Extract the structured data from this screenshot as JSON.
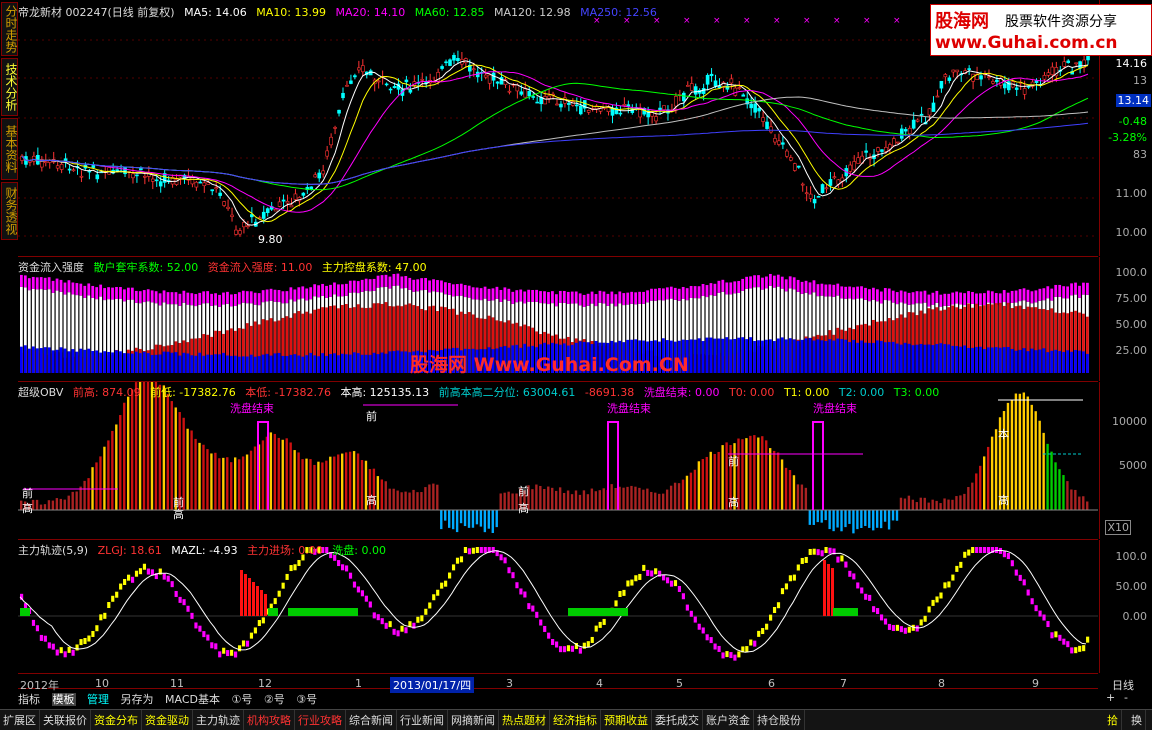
{
  "left_tabs": [
    "分时走势",
    "技术分析",
    "基本资料",
    "财务透视"
  ],
  "main_header": {
    "stock": "帝龙新材 002247(日线 前复权)",
    "ma5": "MA5: 14.06",
    "ma10": "MA10: 13.99",
    "ma20": "MA20: 14.10",
    "ma60": "MA60: 12.85",
    "ma120": "MA120: 12.98",
    "ma250": "MA250: 12.56"
  },
  "main_axis": [
    "14.16",
    "13",
    "13.14",
    "-0.48",
    "-3.28%",
    "83",
    "11.00",
    "10.00"
  ],
  "low_marker": "9.80",
  "fund_header": {
    "title": "资金流入强度",
    "retail": "散户套牢系数: 52.00",
    "inflow": "资金流入强度: 11.00",
    "control": "主力控盘系数: 47.00"
  },
  "fund_axis": [
    "100.0",
    "75.00",
    "50.00",
    "25.00"
  ],
  "obv_header": {
    "title": "超级OBV",
    "prev_high": "前高: 874.09",
    "prev_low": "前低: -17382.76",
    "this_low": "本低: -17382.76",
    "this_high": "本高: 125135.13",
    "median": "前高本高二分位: 63004.61",
    "val": "-8691.38",
    "wash": "洗盘结束: 0.00",
    "t0": "T0: 0.00",
    "t1": "T1: 0.00",
    "t2": "T2: 0.00",
    "t3": "T3: 0.00"
  },
  "obv_axis": [
    "10000",
    "5000",
    "X10"
  ],
  "obv_labels": {
    "wash_end": "洗盘结束",
    "prev": "前",
    "high": "高",
    "this": "本"
  },
  "track_header": {
    "title": "主力轨迹(5,9)",
    "zlgj": "ZLGJ: 18.61",
    "mazl": "MAZL: -4.93",
    "enter": "主力进场: 0.00",
    "wash": "洗盘: 0.00"
  },
  "track_axis": [
    "100.0",
    "50.00",
    "0.00"
  ],
  "x_labels": [
    "2012年",
    "10",
    "11",
    "12",
    "1",
    "3",
    "4",
    "5",
    "6",
    "7",
    "8",
    "9"
  ],
  "date_box": "2013/01/17/四",
  "period": "日线",
  "bottom_tabs": [
    "指标",
    "模板",
    "管理",
    "另存为",
    "MACD基本",
    "①号",
    "②号",
    "③号"
  ],
  "nav": [
    "扩展区",
    "关联报价",
    "资金分布",
    "资金驱动",
    "主力轨迹",
    "机构攻略",
    "行业攻略",
    "综合新闻",
    "行业新闻",
    "网摘新闻",
    "热点题材",
    "经济指标",
    "预期收益",
    "委托成交",
    "账户资金",
    "持仓股份"
  ],
  "nav_right": [
    "拾",
    "换"
  ],
  "zoom": [
    "+",
    "-"
  ],
  "logo": {
    "cn": "股海网",
    "slogan": "股票软件资源分享",
    "url": "www.Guhai.com.cn"
  },
  "watermark": "股海网 Www.Guhai.Com.CN",
  "colors": {
    "up": "#ff3333",
    "down": "#00ffff",
    "ma5": "#ffffff",
    "ma10": "#ffff00",
    "ma20": "#ff00ff",
    "ma60": "#00ff00",
    "ma120": "#c0c0c0",
    "ma250": "#4040ff",
    "magenta": "#ff00ff",
    "blue": "#0000ff",
    "frame": "#800000"
  }
}
